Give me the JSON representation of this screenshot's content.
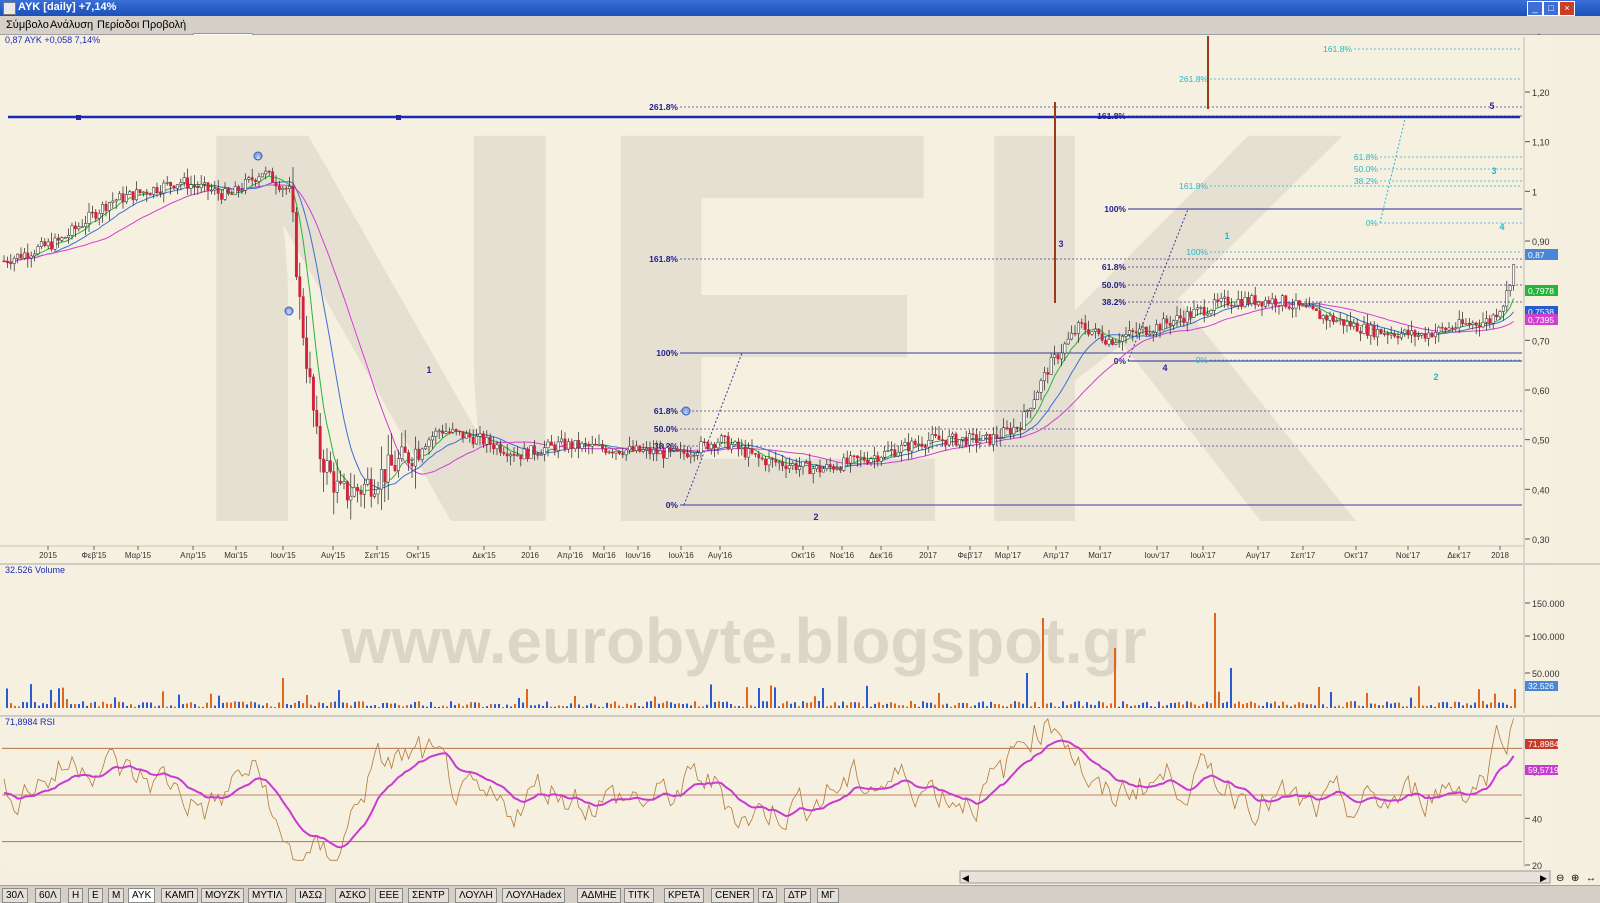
{
  "window": {
    "title": "ΑΥΚ [daily] +7,14%"
  },
  "menu": [
    "Σύμβολο",
    "Ανάλυση",
    "Περίοδοι",
    "Προβολή"
  ],
  "search": {
    "value": ""
  },
  "toolbar_icons": [
    "cursor-icon",
    "crosshair-icon",
    "rectangle-icon",
    "line-icon",
    "grid-icon",
    "window-icon",
    "save-icon"
  ],
  "price_pane": {
    "label": "0,87 ΑΥΚ +0,058 7,14%",
    "watermark": "NEK",
    "y_ticks": [
      "1,20",
      "1,10",
      "1",
      "0,90",
      "0,80",
      "0,70",
      "0,60",
      "0,50",
      "0,40",
      "0,30"
    ],
    "x_ticks": [
      "2015",
      "Φεβ'15",
      "Μαρ'15",
      "Απρ'15",
      "Μαι'15",
      "Ιουν'15",
      "Αυγ'15",
      "Σεπ'15",
      "Οκτ'15",
      "Δεκ'15",
      "2016",
      "Απρ'16",
      "Μαι'16",
      "Ιουν'16",
      "Ιουλ'16",
      "Αυγ'16",
      "Οκτ'16",
      "Νοε'16",
      "Δεκ'16",
      "2017",
      "Φεβ'17",
      "Μαρ'17",
      "Απρ'17",
      "Μαι'17",
      "Ιουν'17",
      "Ιουλ'17",
      "Αυγ'17",
      "Σεπ'17",
      "Οκτ'17",
      "Νοε'17",
      "Δεκ'17",
      "2018"
    ],
    "price_tags": [
      {
        "text": "0,87",
        "color": "#4a86d6"
      },
      {
        "text": "0,7978",
        "color": "#27b43a"
      },
      {
        "text": "0,7538",
        "color": "#2a5ad0"
      },
      {
        "text": "0,7395",
        "color": "#d23fd0"
      }
    ],
    "fib_labels_left": [
      "261.8%",
      "161.8%",
      "100%",
      "61.8%",
      "50.0%",
      "38.2%",
      "0%"
    ],
    "fib_labels_mid": [
      "161.8%",
      "100%",
      "61.8%",
      "50.0%",
      "38.2%",
      "0%"
    ],
    "fib_labels_right": [
      "161.8%",
      "261.8%",
      "161.8%",
      "61.8%",
      "50.0%",
      "38.2%",
      "0%",
      "100%",
      "0%"
    ],
    "wave_labels": [
      "1",
      "2",
      "3",
      "4",
      "1",
      "2",
      "3",
      "4",
      "5"
    ],
    "annotation_markers": [
      "a",
      "b",
      "c"
    ]
  },
  "volume_pane": {
    "label": "32.526 Volume",
    "watermark": "www.eurobyte.blogspot.gr",
    "y_ticks": [
      "150.000",
      "100.000",
      "50.000"
    ],
    "last_tag": "32.526"
  },
  "rsi_pane": {
    "label": "71,8984 RSI",
    "y_ticks": [
      "60",
      "40",
      "20"
    ],
    "tag_rsi": "71,8984",
    "tag_signal": "59,5719"
  },
  "tabs": [
    "30Λ",
    "60Λ",
    "Η",
    "Ε",
    "Μ",
    "ΑΥΚ",
    "ΚΑΜΠ",
    "ΜΟΥΖΚ",
    "ΜΥΤΙΛ",
    "ΙΑΣΩ",
    "ΑΣΚΟ",
    "ΕΕΕ",
    "ΣΕΝΤΡ",
    "ΛΟΥΛΗ",
    "ΛΟΥΛΗadex",
    "ΑΔΜΗΕ",
    "ΤΙΤΚ",
    "ΚΡΕΤΑ",
    "CENER",
    "ΓΔ",
    "ΔΤΡ",
    "ΜΓ"
  ],
  "colors": {
    "up_candle": "#ffffff",
    "down_candle": "#d2223a",
    "fib_line": "#2a2aa0",
    "fib_line_light": "#29b6c8",
    "ma_green": "#27b43a",
    "ma_blue": "#3b6fd0",
    "ma_magenta": "#d23fd0",
    "resistance": "#1a2ab8",
    "rsi_line": "#b07a3a",
    "rsi_signal": "#c83ad0"
  }
}
